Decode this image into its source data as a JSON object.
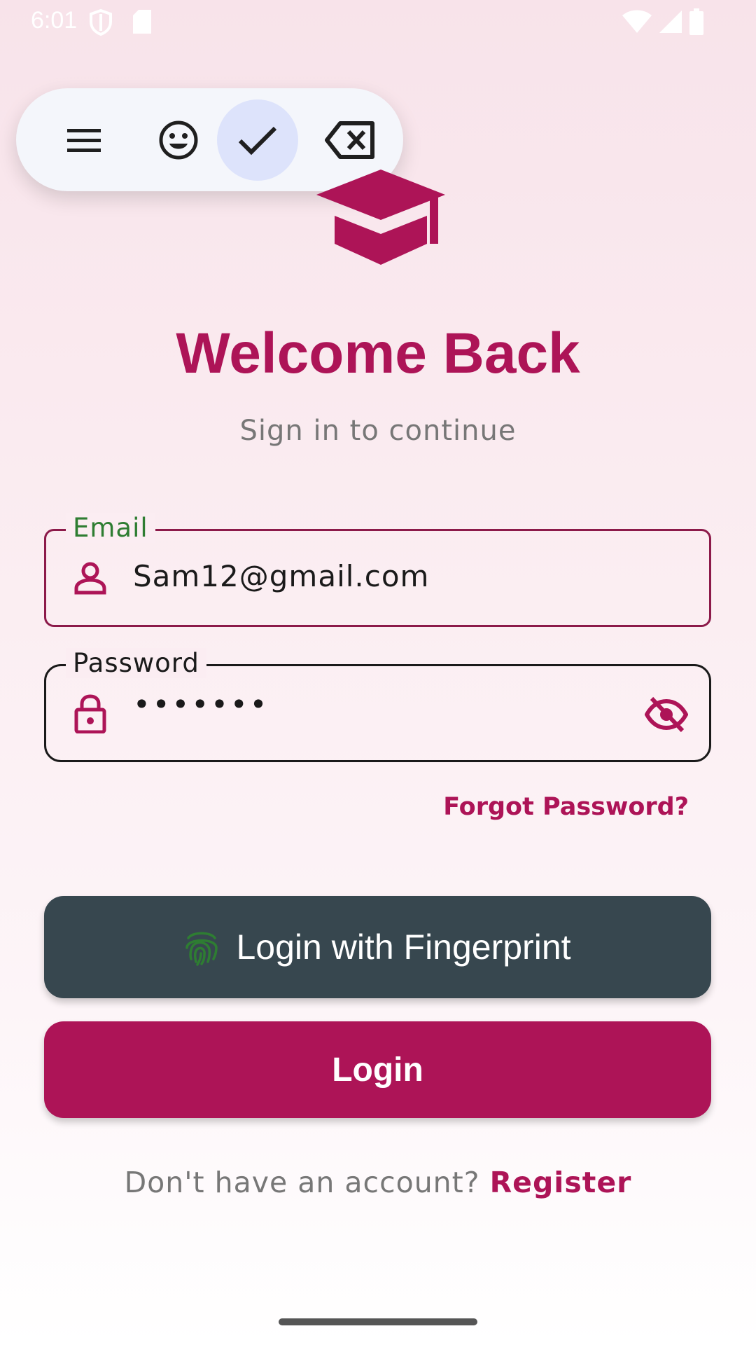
{
  "status_bar": {
    "time": "6:01",
    "icons": [
      "shield-icon",
      "sd-card-icon",
      "wifi-icon",
      "signal-icon",
      "battery-icon"
    ]
  },
  "keyboard_toolbar": {
    "items": [
      "menu-icon",
      "emoji-icon",
      "check-icon",
      "backspace-icon"
    ],
    "active_item": "check-icon"
  },
  "header": {
    "logo": "graduation-cap-icon",
    "title": "Welcome Back",
    "subtitle": "Sign in to continue"
  },
  "form": {
    "email": {
      "label": "Email",
      "value": "Sam12@gmail.com",
      "icon": "person-icon"
    },
    "password": {
      "label": "Password",
      "value": "•••••••",
      "icon": "lock-icon",
      "toggle_icon": "visibility-off-icon"
    },
    "forgot_password": "Forgot Password?"
  },
  "actions": {
    "fingerprint_button": "Login with Fingerprint",
    "login_button": "Login"
  },
  "footer": {
    "prompt": "Don't have an account?",
    "register_link": "Register"
  },
  "colors": {
    "primary": "#ad1457",
    "fingerprint_button_bg": "#37474f",
    "email_label": "#2e7d32",
    "muted_text": "#777777"
  }
}
